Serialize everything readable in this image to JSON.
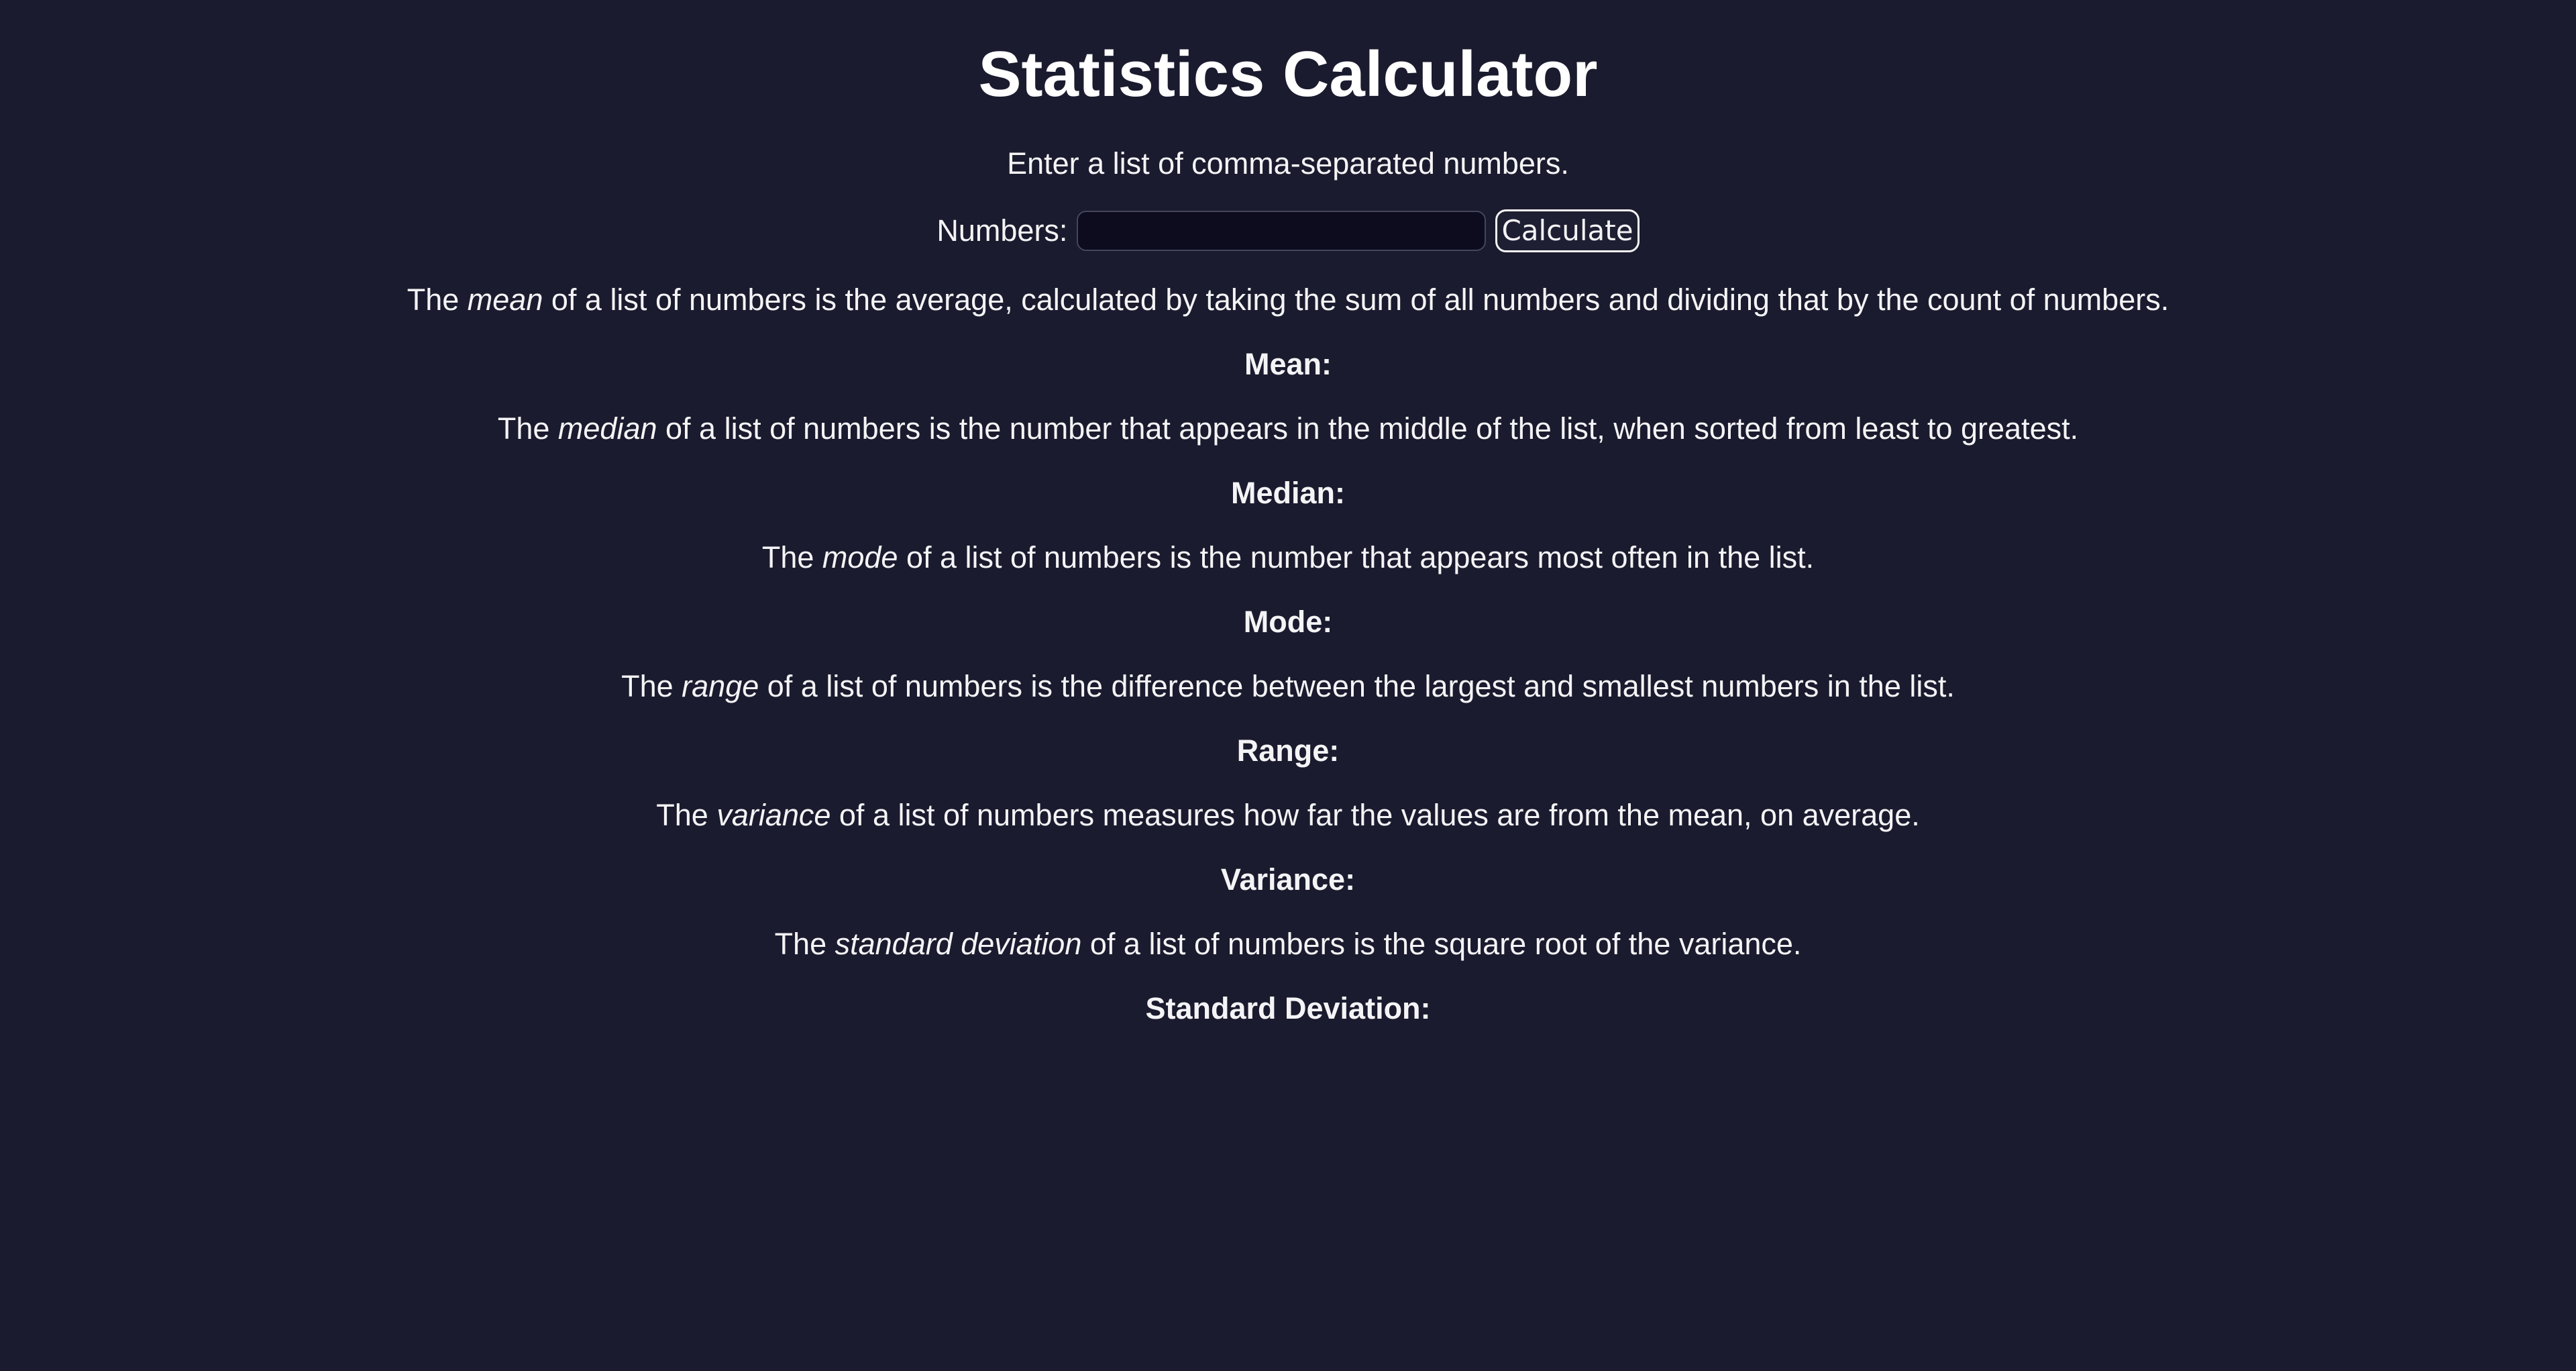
{
  "page": {
    "title": "Statistics Calculator",
    "subtitle": "Enter a list of comma-separated numbers."
  },
  "form": {
    "numbers_label": "Numbers:",
    "numbers_value": "",
    "numbers_placeholder": "",
    "calculate_label": "Calculate"
  },
  "sections": {
    "mean": {
      "before": "The ",
      "term": "mean",
      "after": " of a list of numbers is the average, calculated by taking the sum of all numbers and dividing that by the count of numbers.",
      "result_label": "Mean:"
    },
    "median": {
      "before": "The ",
      "term": "median",
      "after": " of a list of numbers is the number that appears in the middle of the list, when sorted from least to greatest.",
      "result_label": "Median:"
    },
    "mode": {
      "before": "The ",
      "term": "mode",
      "after": " of a list of numbers is the number that appears most often in the list.",
      "result_label": "Mode:"
    },
    "range": {
      "before": "The ",
      "term": "range",
      "after": " of a list of numbers is the difference between the largest and smallest numbers in the list.",
      "result_label": "Range:"
    },
    "variance": {
      "before": "The ",
      "term": "variance",
      "after": " of a list of numbers measures how far the values are from the mean, on average.",
      "result_label": "Variance:"
    },
    "std": {
      "before": "The ",
      "term": "standard deviation",
      "after": " of a list of numbers is the square root of the variance.",
      "result_label": "Standard Deviation:"
    }
  },
  "colors": {
    "background": "#1b1b2f",
    "text": "#f4f4f6",
    "input_background": "#0c0c1e"
  }
}
